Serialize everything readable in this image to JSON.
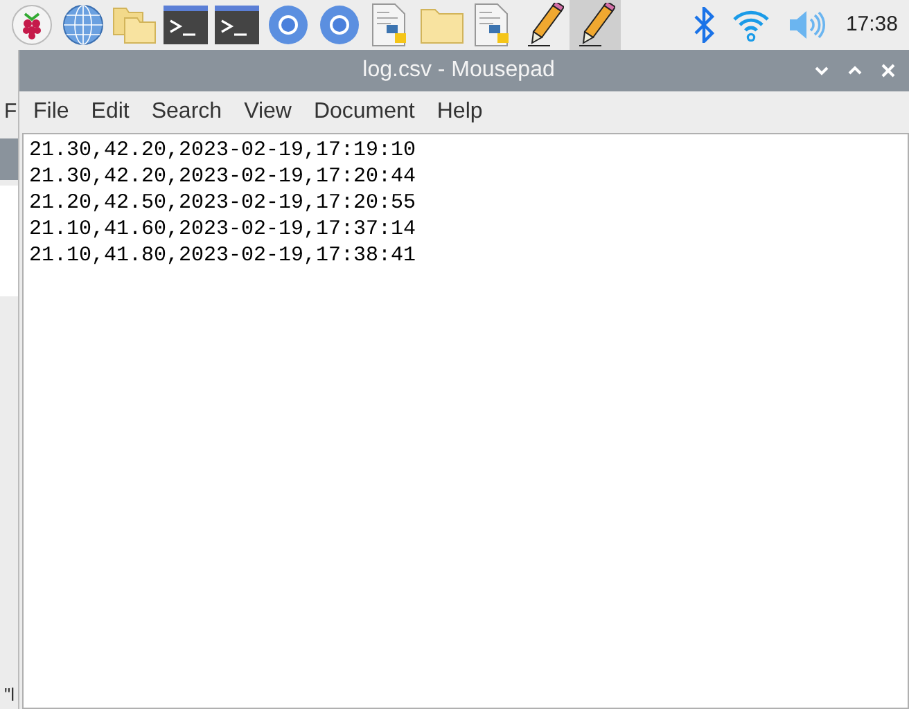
{
  "taskbar": {
    "launchers": [
      {
        "kind": "raspberry",
        "selected": false
      },
      {
        "kind": "globe",
        "selected": false
      },
      {
        "kind": "folders",
        "selected": false
      },
      {
        "kind": "terminal",
        "selected": false
      },
      {
        "kind": "terminal",
        "selected": false
      },
      {
        "kind": "chromium",
        "selected": false
      },
      {
        "kind": "chromium",
        "selected": false
      },
      {
        "kind": "python-file",
        "selected": false
      },
      {
        "kind": "folder",
        "selected": false
      },
      {
        "kind": "python-file",
        "selected": false
      },
      {
        "kind": "pencil",
        "selected": false
      },
      {
        "kind": "pencil",
        "selected": true
      }
    ],
    "tray": [
      {
        "kind": "bluetooth"
      },
      {
        "kind": "wifi"
      },
      {
        "kind": "volume"
      }
    ],
    "clock": "17:38"
  },
  "background_window": {
    "menu_letter": "F",
    "status_text": "\"l"
  },
  "window": {
    "title": "log.csv - Mousepad",
    "menu": [
      "File",
      "Edit",
      "Search",
      "View",
      "Document",
      "Help"
    ],
    "lines": [
      "21.30,42.20,2023-02-19,17:19:10",
      "21.30,42.20,2023-02-19,17:20:44",
      "21.20,42.50,2023-02-19,17:20:55",
      "21.10,41.60,2023-02-19,17:37:14",
      "21.10,41.80,2023-02-19,17:38:41"
    ]
  }
}
